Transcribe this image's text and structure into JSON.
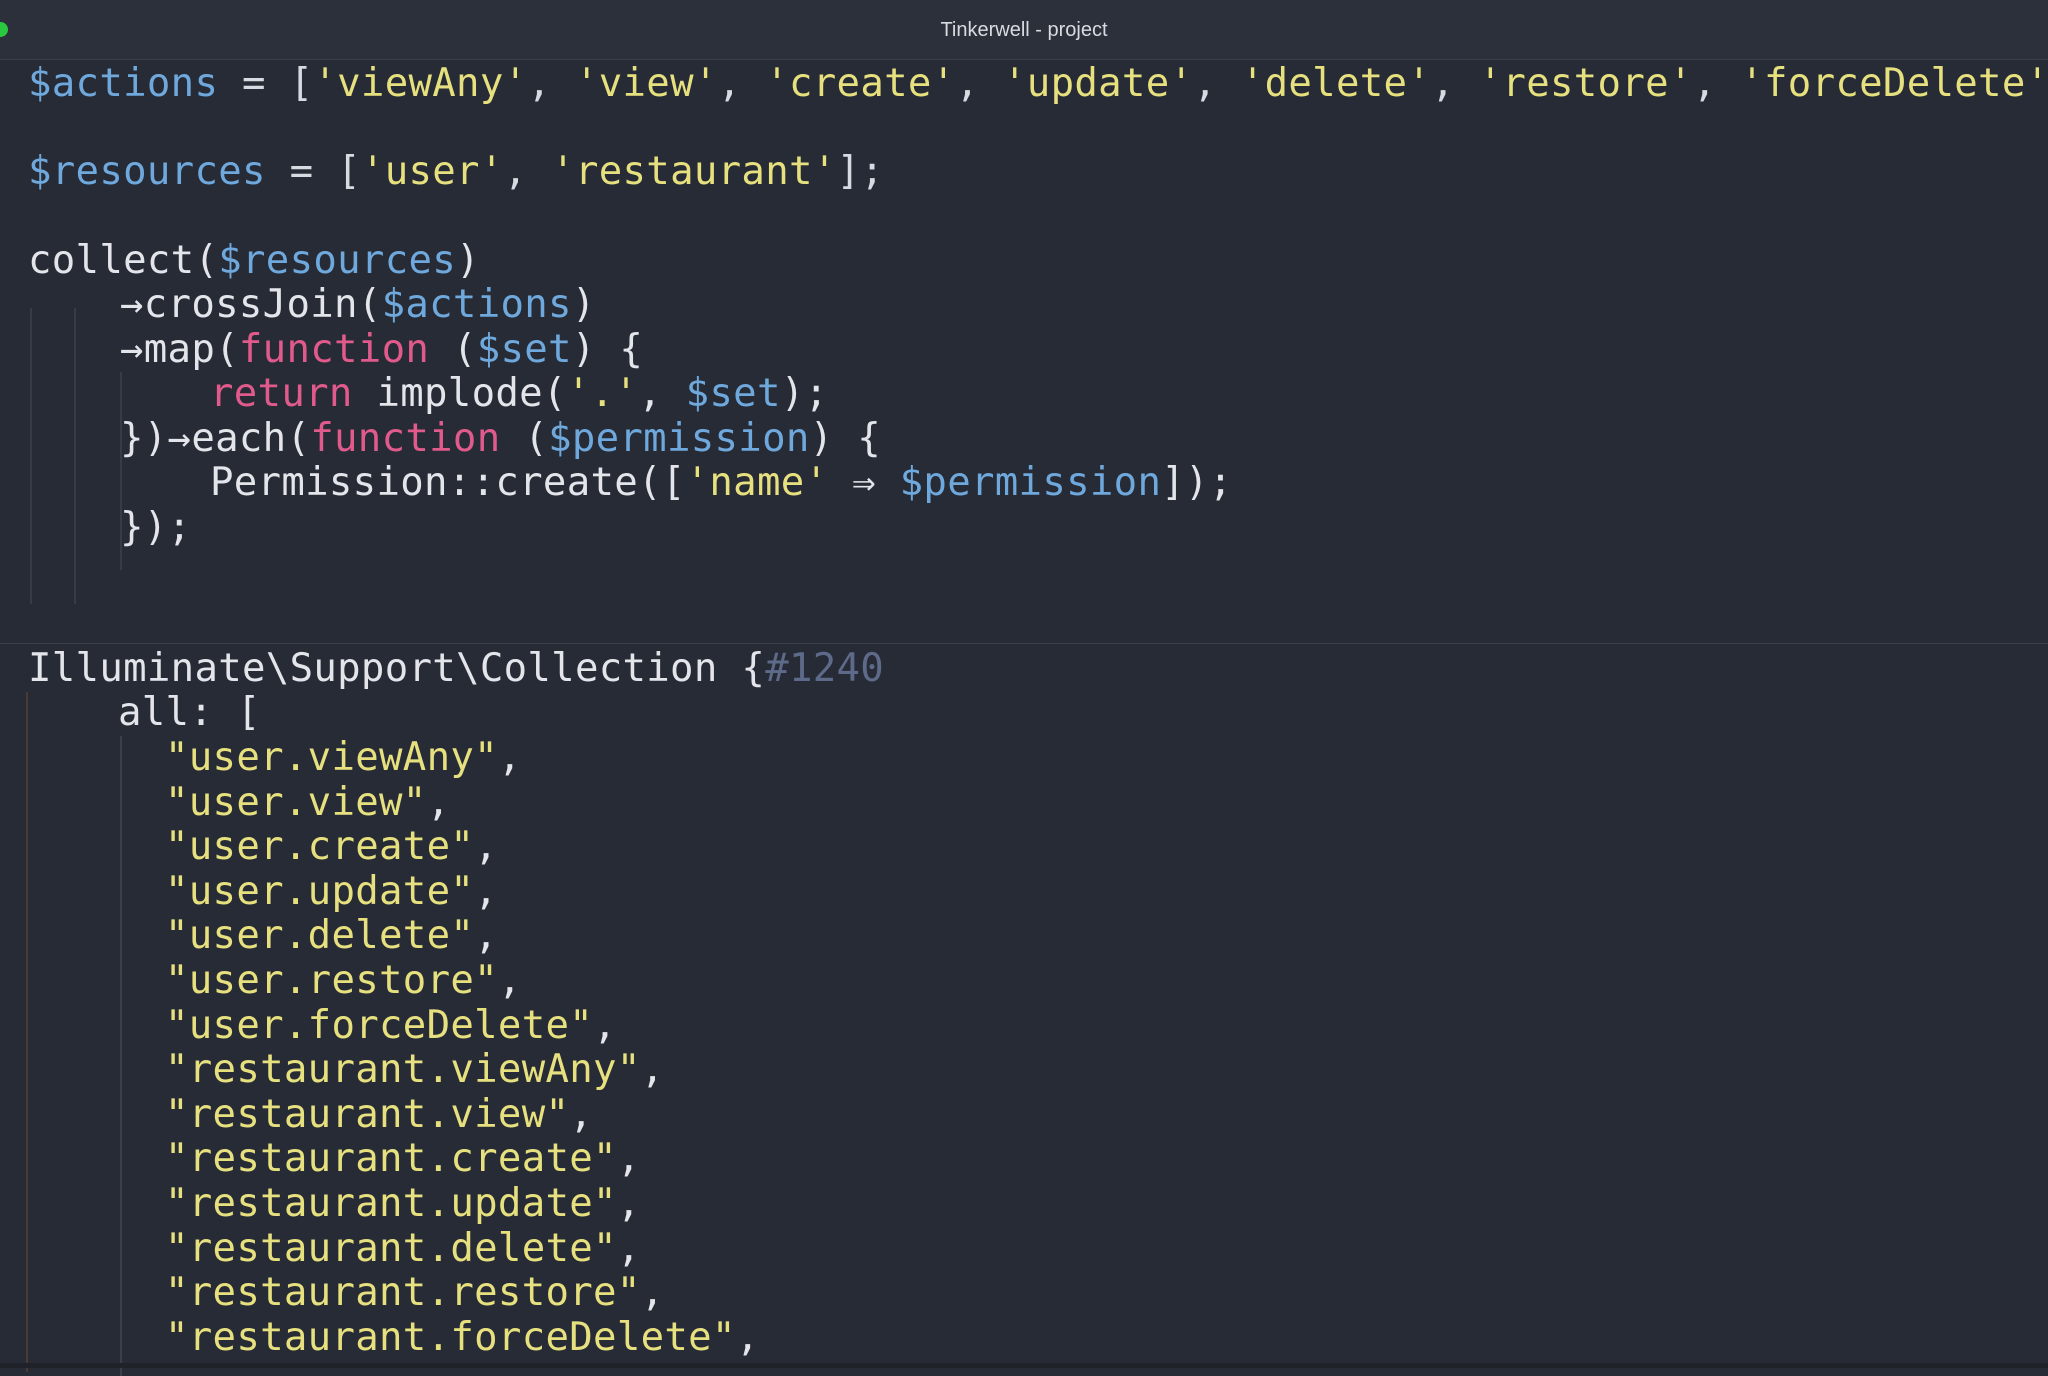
{
  "window": {
    "title": "Tinkerwell - project"
  },
  "editor": {
    "actions_var": "$actions",
    "equals": " = ",
    "actions_items": [
      "'viewAny'",
      "'view'",
      "'create'",
      "'update'",
      "'delete'",
      "'restore'",
      "'forceDelete'"
    ],
    "resources_var": "$resources",
    "resources_items": [
      "'user'",
      "'restaurant'"
    ],
    "collect_fn": "collect(",
    "collect_close": ")",
    "arrow1": "→crossJoin(",
    "arrow2": "→map(",
    "function_kw": "function",
    "set_var": "$set",
    "brace_open": ") {",
    "return_kw": "return",
    "implode_call": " implode(",
    "dot_str": "'.'",
    "implode_end": ");",
    "each_prefix": "})→each(",
    "permission_var": "$permission",
    "permission_create": "Permission::create([",
    "name_str": "'name'",
    "fat_arrow": " ⇒ ",
    "create_end": "]);",
    "close_all": "});"
  },
  "output": {
    "class_name": "Illuminate\\Support\\Collection {",
    "object_id": "#1240",
    "all_label": "all: [",
    "items": [
      "\"user.viewAny\"",
      "\"user.view\"",
      "\"user.create\"",
      "\"user.update\"",
      "\"user.delete\"",
      "\"user.restore\"",
      "\"user.forceDelete\"",
      "\"restaurant.viewAny\"",
      "\"restaurant.view\"",
      "\"restaurant.create\"",
      "\"restaurant.update\"",
      "\"restaurant.delete\"",
      "\"restaurant.restore\"",
      "\"restaurant.forceDelete\""
    ],
    "comma": ","
  },
  "colors": {
    "background": "#272b35",
    "variable": "#6fa8dc",
    "string": "#e7e07f",
    "keyword": "#e05a8c"
  }
}
